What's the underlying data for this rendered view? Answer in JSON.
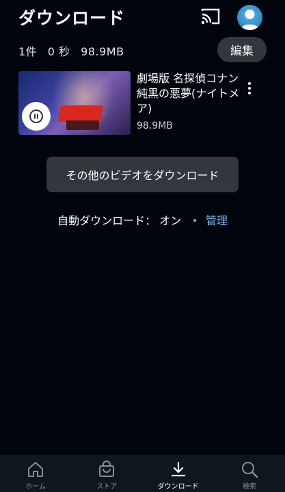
{
  "header": {
    "title": "ダウンロード",
    "cast_icon": "cast-icon",
    "avatar_icon": "user-avatar-icon"
  },
  "summary": {
    "count": "1件",
    "duration": "0 秒",
    "size": "98.9MB"
  },
  "edit_label": "編集",
  "downloads": [
    {
      "title": "劇場版 名探偵コナン 純黒の悪夢(ナイトメア)",
      "size": "98.9MB",
      "state_icon": "pause-icon"
    }
  ],
  "other_videos_label": "その他のビデオをダウンロード",
  "auto_download": {
    "label": "自動ダウンロード：",
    "status": "オン",
    "separator": "•",
    "manage_label": "管理"
  },
  "nav": [
    {
      "label": "ホーム",
      "icon": "home-icon",
      "active": false
    },
    {
      "label": "ストア",
      "icon": "store-bag-icon",
      "active": false
    },
    {
      "label": "ダウンロード",
      "icon": "download-icon",
      "active": true
    },
    {
      "label": "検索",
      "icon": "search-icon",
      "active": false
    }
  ],
  "colors": {
    "background": "#00050d",
    "button_bg": "#33373d",
    "link": "#79b8f3",
    "nav_bg": "#0f171e"
  }
}
